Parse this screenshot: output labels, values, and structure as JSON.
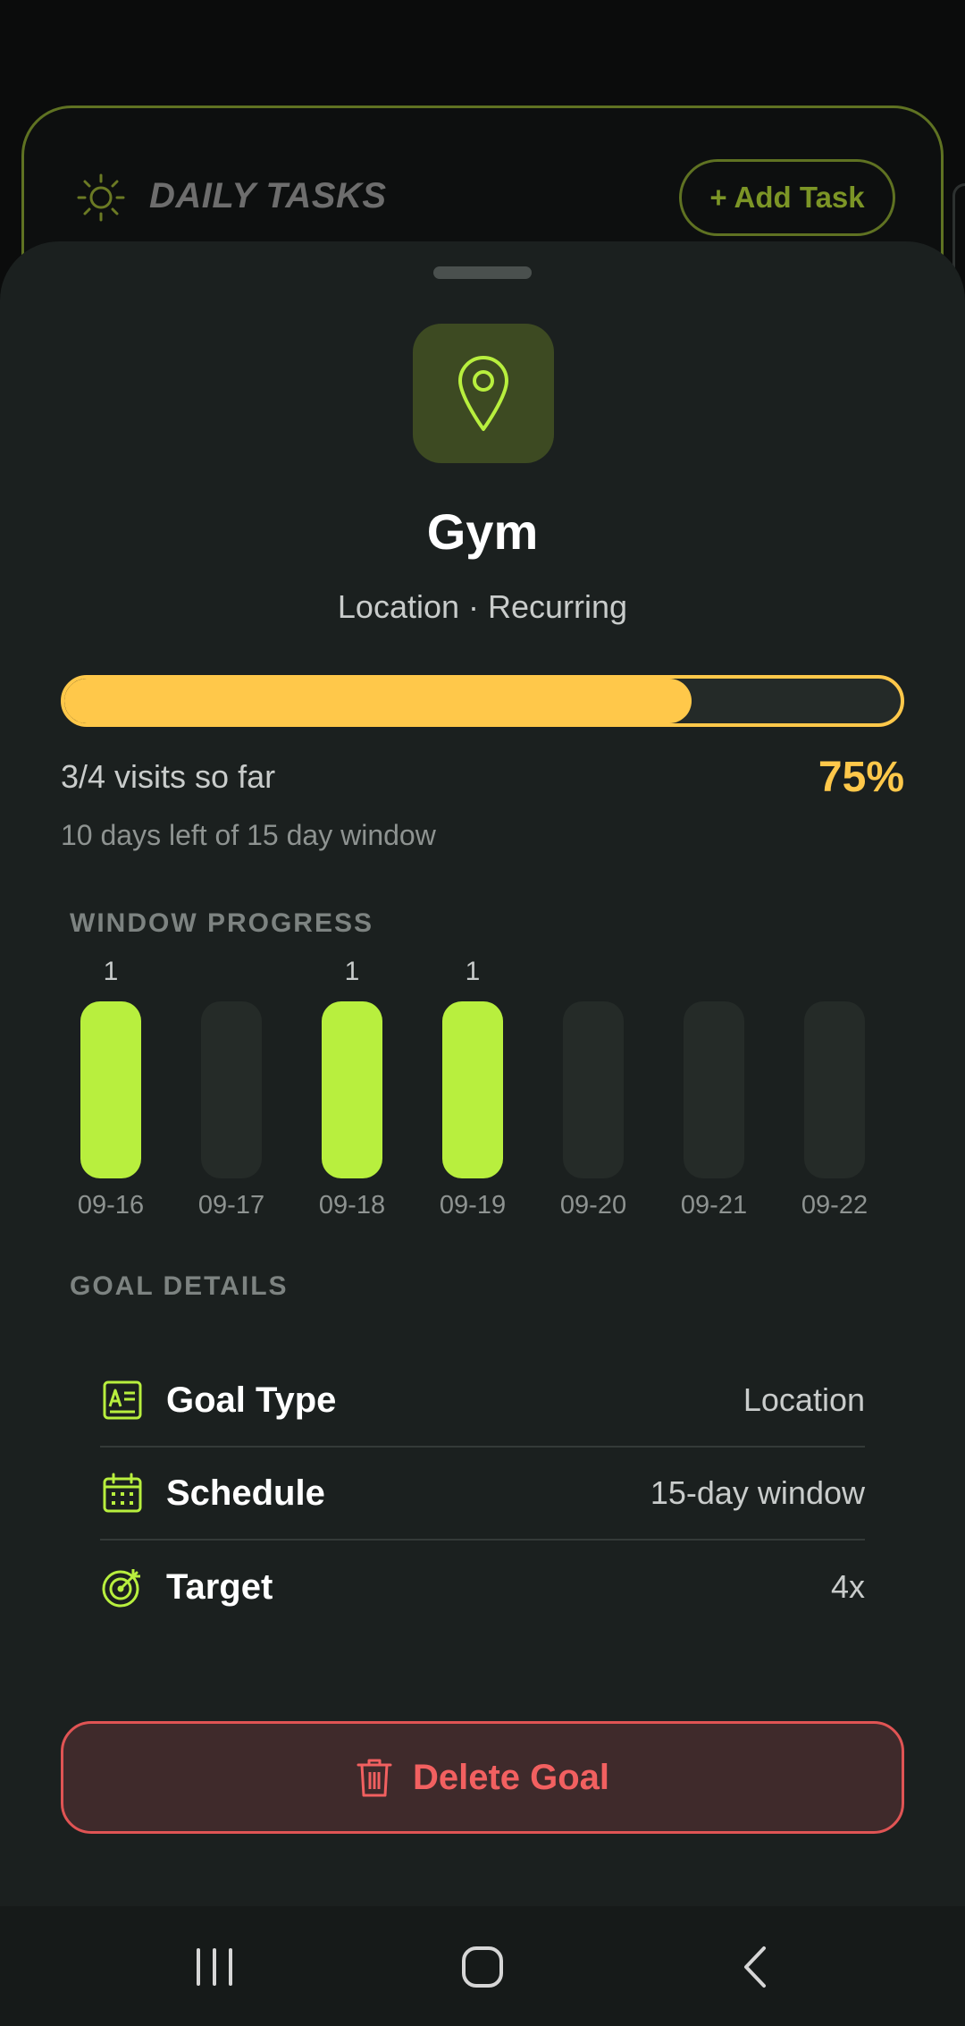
{
  "background": {
    "title": "DAILY TASKS",
    "add_button": "+ Add Task"
  },
  "goal": {
    "icon": "location-pin-icon",
    "name": "Gym",
    "subtitle": "Location · Recurring",
    "progress_fraction": 0.75,
    "visits_text": "3/4 visits so far",
    "percent_text": "75%",
    "days_left_text": "10 days left of 15 day window"
  },
  "window_progress": {
    "label": "WINDOW PROGRESS",
    "days": [
      {
        "date": "09-16",
        "count": "1",
        "done": true
      },
      {
        "date": "09-17",
        "count": "",
        "done": false
      },
      {
        "date": "09-18",
        "count": "1",
        "done": true
      },
      {
        "date": "09-19",
        "count": "1",
        "done": true
      },
      {
        "date": "09-20",
        "count": "",
        "done": false
      },
      {
        "date": "09-21",
        "count": "",
        "done": false
      },
      {
        "date": "09-22",
        "count": "",
        "done": false
      }
    ]
  },
  "goal_details": {
    "label": "GOAL DETAILS",
    "rows": [
      {
        "icon": "card-text-icon",
        "label": "Goal Type",
        "value": "Location"
      },
      {
        "icon": "calendar-icon",
        "label": "Schedule",
        "value": "15-day window"
      },
      {
        "icon": "target-icon",
        "label": "Target",
        "value": "4x"
      }
    ]
  },
  "actions": {
    "delete_label": "Delete Goal"
  },
  "colors": {
    "accent_lime": "#b8ef3e",
    "accent_amber": "#ffc84a",
    "danger": "#f26060",
    "sheet_bg": "#1b201f"
  },
  "nav": {
    "recents": "recents-icon",
    "home": "home-icon",
    "back": "back-icon"
  }
}
